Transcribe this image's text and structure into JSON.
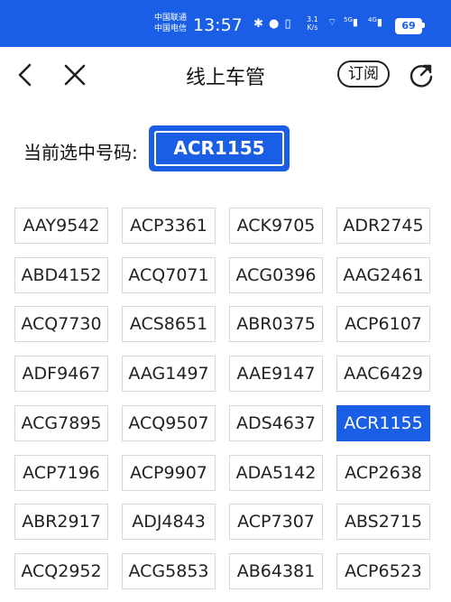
{
  "status_bar": {
    "carrier_1": "中国联通",
    "carrier_2": "中国电信",
    "time": "13:57",
    "net_speed": "3.1",
    "net_unit": "K/s",
    "signal_1": "5G",
    "signal_2": "4G",
    "battery": "69"
  },
  "nav": {
    "title": "线上车管",
    "subscribe_label": "订阅",
    "back_icon": "chevron-left-icon",
    "close_icon": "close-icon",
    "refresh_icon": "refresh-icon"
  },
  "selection": {
    "label": "当前选中号码:",
    "value": "ACR1155"
  },
  "colors": {
    "accent": "#1a5ee6"
  },
  "plates": [
    {
      "number": "AAY9542",
      "selected": false
    },
    {
      "number": "ACP3361",
      "selected": false
    },
    {
      "number": "ACK9705",
      "selected": false
    },
    {
      "number": "ADR2745",
      "selected": false
    },
    {
      "number": "ABD4152",
      "selected": false
    },
    {
      "number": "ACQ7071",
      "selected": false
    },
    {
      "number": "ACG0396",
      "selected": false
    },
    {
      "number": "AAG2461",
      "selected": false
    },
    {
      "number": "ACQ7730",
      "selected": false
    },
    {
      "number": "ACS8651",
      "selected": false
    },
    {
      "number": "ABR0375",
      "selected": false
    },
    {
      "number": "ACP6107",
      "selected": false
    },
    {
      "number": "ADF9467",
      "selected": false
    },
    {
      "number": "AAG1497",
      "selected": false
    },
    {
      "number": "AAE9147",
      "selected": false
    },
    {
      "number": "AAC6429",
      "selected": false
    },
    {
      "number": "ACG7895",
      "selected": false
    },
    {
      "number": "ACQ9507",
      "selected": false
    },
    {
      "number": "ADS4637",
      "selected": false
    },
    {
      "number": "ACR1155",
      "selected": true
    },
    {
      "number": "ACP7196",
      "selected": false
    },
    {
      "number": "ACP9907",
      "selected": false
    },
    {
      "number": "ADA5142",
      "selected": false
    },
    {
      "number": "ACP2638",
      "selected": false
    },
    {
      "number": "ABR2917",
      "selected": false
    },
    {
      "number": "ADJ4843",
      "selected": false
    },
    {
      "number": "ACP7307",
      "selected": false
    },
    {
      "number": "ABS2715",
      "selected": false
    },
    {
      "number": "ACQ2952",
      "selected": false
    },
    {
      "number": "ACG5853",
      "selected": false
    },
    {
      "number": "AB64381",
      "selected": false
    },
    {
      "number": "ACP6523",
      "selected": false
    }
  ]
}
